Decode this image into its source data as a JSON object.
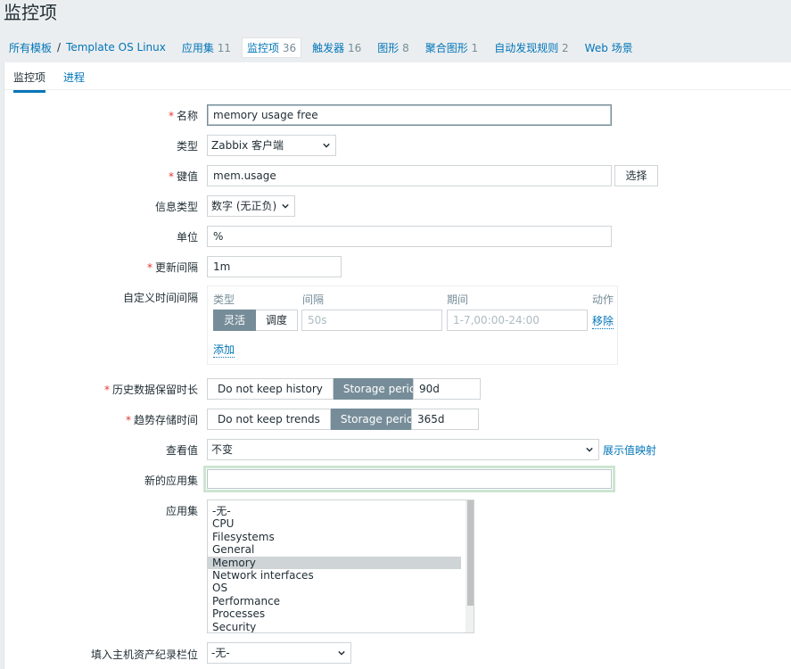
{
  "page": {
    "title": "监控项"
  },
  "breadcrumbs": {
    "all_templates": "所有模板",
    "separator": "/",
    "template": "Template OS Linux",
    "items": [
      {
        "label": "应用集",
        "count": "11"
      },
      {
        "label": "监控项",
        "count": "36"
      },
      {
        "label": "触发器",
        "count": "16"
      },
      {
        "label": "图形",
        "count": "8"
      },
      {
        "label": "聚合图形",
        "count": "1"
      },
      {
        "label": "自动发现规则",
        "count": "2"
      },
      {
        "label": "Web 场景",
        "count": ""
      }
    ]
  },
  "tabs": [
    {
      "label": "监控项"
    },
    {
      "label": "进程"
    }
  ],
  "form": {
    "name": {
      "label": "名称",
      "value": "memory usage free"
    },
    "type": {
      "label": "类型",
      "value": "Zabbix 客户端"
    },
    "key": {
      "label": "键值",
      "value": "mem.usage",
      "select_button": "选择"
    },
    "info_type": {
      "label": "信息类型",
      "value": "数字 (无正负)"
    },
    "units": {
      "label": "单位",
      "value": "%"
    },
    "interval": {
      "label": "更新间隔",
      "value": "1m"
    },
    "custom_intervals": {
      "label": "自定义时间间隔",
      "headers": {
        "type": "类型",
        "interval": "间隔",
        "period": "期间",
        "action": "动作"
      },
      "type_options": [
        "灵活",
        "调度"
      ],
      "interval_placeholder": "50s",
      "period_placeholder": "1-7,00:00-24:00",
      "remove": "移除",
      "add": "添加"
    },
    "history": {
      "label": "历史数据保留时长",
      "options": [
        "Do not keep history",
        "Storage period"
      ],
      "value": "90d"
    },
    "trends": {
      "label": "趋势存储时间",
      "options": [
        "Do not keep trends",
        "Storage period"
      ],
      "value": "365d"
    },
    "value_map": {
      "label": "查看值",
      "value": "不变",
      "link": "展示值映射"
    },
    "new_application": {
      "label": "新的应用集",
      "value": ""
    },
    "applications": {
      "label": "应用集",
      "items": [
        "-无-",
        "CPU",
        "Filesystems",
        "General",
        "Memory",
        "Network interfaces",
        "OS",
        "Performance",
        "Processes",
        "Security"
      ],
      "selected": "Memory"
    },
    "inventory": {
      "label": "填入主机资产纪录栏位",
      "value": "-无-"
    }
  }
}
